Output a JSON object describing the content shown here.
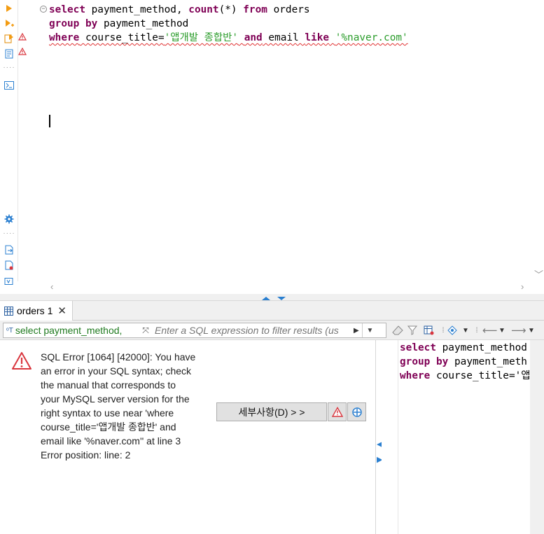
{
  "editor": {
    "lines": [
      [
        {
          "t": "select",
          "c": "kw"
        },
        {
          "t": " payment_method, ",
          "c": ""
        },
        {
          "t": "count",
          "c": "kw"
        },
        {
          "t": "(*) ",
          "c": ""
        },
        {
          "t": "from",
          "c": "kw"
        },
        {
          "t": " orders",
          "c": ""
        }
      ],
      [
        {
          "t": "group",
          "c": "kw"
        },
        {
          "t": " ",
          "c": ""
        },
        {
          "t": "by",
          "c": "kw"
        },
        {
          "t": " payment_method",
          "c": ""
        }
      ],
      [
        {
          "t": "where",
          "c": "kw"
        },
        {
          "t": " course_title=",
          "c": ""
        },
        {
          "t": "'앱개발 종합반'",
          "c": "str"
        },
        {
          "t": " ",
          "c": ""
        },
        {
          "t": "and",
          "c": "kw"
        },
        {
          "t": " email ",
          "c": ""
        },
        {
          "t": "like",
          "c": "kw"
        },
        {
          "t": " ",
          "c": ""
        },
        {
          "t": "'%naver.com'",
          "c": "str"
        }
      ]
    ],
    "error_line_index": 2
  },
  "results": {
    "tab_label": "orders 1",
    "query_chip": "select payment_method,",
    "filter_placeholder": "Enter a SQL expression to filter results (us",
    "error_lines": [
      "SQL Error [1064] [42000]: You have",
      "an error in your SQL syntax; check",
      "the manual that corresponds to",
      "your MySQL server version for the",
      "right syntax to use near 'where",
      "course_title='앱개발 종합반' and",
      "email like '%naver.com'' at line 3",
      "Error position: line: 2"
    ],
    "details_button_label": "세부사항(D) > >",
    "preview_lines": [
      [
        {
          "t": "select",
          "c": "kw"
        },
        {
          "t": " payment_method",
          "c": ""
        }
      ],
      [
        {
          "t": "group",
          "c": "kw"
        },
        {
          "t": " ",
          "c": ""
        },
        {
          "t": "by",
          "c": "kw"
        },
        {
          "t": " payment_meth",
          "c": ""
        }
      ],
      [
        {
          "t": "where",
          "c": "kw"
        },
        {
          "t": " course_title='앱",
          "c": ""
        }
      ]
    ]
  },
  "colors": {
    "keyword": "#7f0055",
    "string": "#2a9c2a",
    "query_chip": "#1f7a1f",
    "error": "#d9363e",
    "accent": "#2a7fd0"
  }
}
